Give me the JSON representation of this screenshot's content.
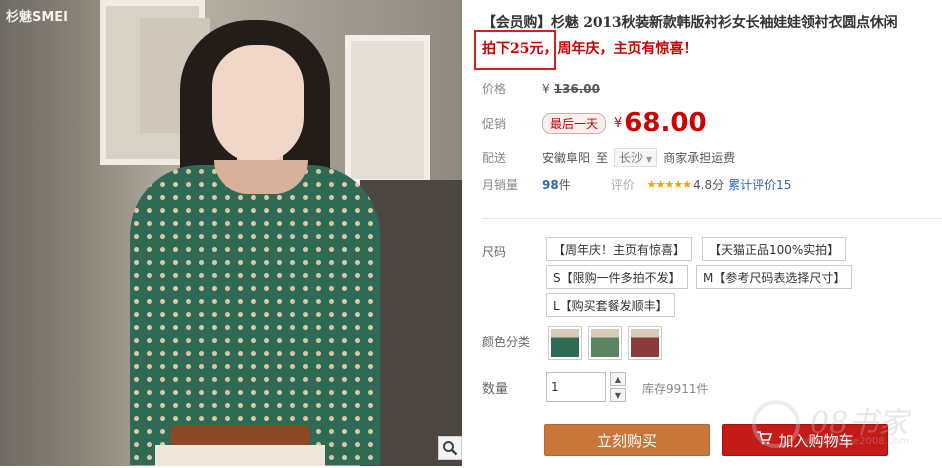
{
  "gallery": {
    "brand_text": "杉魅SMEI",
    "brand_subtitle": "",
    "zoom_icon": "magnifier-icon"
  },
  "product": {
    "title": "【会员购】杉魅 2013秋装新款韩版衬衫女长袖娃娃领衬衣圆点休闲",
    "promo_highlight": "拍下25元，",
    "promo_rest": "周年庆，主页有惊喜！"
  },
  "pricing": {
    "list_label": "价格",
    "currency": "¥",
    "list_price": "136.00",
    "promo_label": "促销",
    "promo_badge": "最后一天",
    "promo_price": "68.00"
  },
  "shipping": {
    "label": "配送",
    "from": "安徽阜阳",
    "to_word": "至",
    "city": "长沙",
    "note": "商家承担运费"
  },
  "stats": {
    "sales_label": "月销量",
    "sales_count": "98",
    "sales_unit": "件",
    "rating_label": "评价",
    "stars": "★★★★★",
    "score": "4.8分",
    "reviews_link": "累计评价15"
  },
  "options": {
    "size_label": "尺码",
    "sizes": [
      "【周年庆！主页有惊喜】",
      "【天猫正品100%实拍】",
      "S【限购一件多拍不发】",
      "M【参考尺码表选择尺寸】",
      "L【购买套餐发顺丰】"
    ],
    "color_label": "颜色分类"
  },
  "quantity": {
    "label": "数量",
    "value": "1",
    "up": "▲",
    "down": "▼",
    "stock": "库存9911件"
  },
  "actions": {
    "buy_now": "立刻购买",
    "add_to_cart": "加入购物车",
    "cart_icon": "🛒"
  },
  "watermark": {
    "text": "08书家",
    "url": "www.home2008.com"
  },
  "colors": {
    "accent_red": "#cc0000",
    "buy_orange": "#c9763b",
    "cart_red": "#c41a18",
    "link_blue": "#2f66b3"
  }
}
